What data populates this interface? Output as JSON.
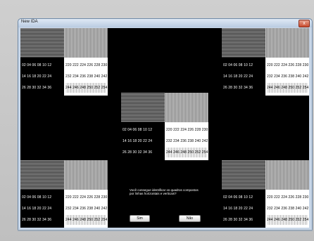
{
  "window": {
    "title": "New IDA",
    "close_symbol": "x"
  },
  "test_panel": {
    "left_rows": [
      [
        "02",
        "04",
        "06",
        "08",
        "10",
        "12"
      ],
      [
        "14",
        "16",
        "18",
        "20",
        "22",
        "24"
      ],
      [
        "26",
        "28",
        "30",
        "32",
        "34",
        "36"
      ]
    ],
    "right_rows": [
      [
        "220",
        "222",
        "224",
        "226",
        "228",
        "230"
      ],
      [
        "232",
        "234",
        "236",
        "238",
        "240",
        "242"
      ],
      [
        "244",
        "246",
        "248",
        "250",
        "252",
        "254"
      ]
    ]
  },
  "question": {
    "line1": "Você consegue identificar os quadros compostos",
    "line2": "por linhas horizontais e verticais?"
  },
  "buttons": {
    "yes": "Sim",
    "no": "Não"
  }
}
